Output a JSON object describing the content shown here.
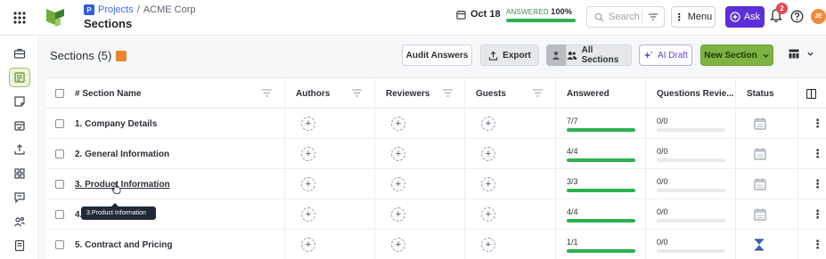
{
  "header": {
    "breadcrumb": {
      "project_link": "Projects",
      "separator": "/",
      "client": "ACME Corp"
    },
    "title": "Sections",
    "date": "Oct 18",
    "answered": {
      "label": "ANSWERED",
      "percent_text": "100%",
      "percent": 100
    },
    "search_placeholder": "Search",
    "menu_label": "Menu",
    "ask_label": "Ask",
    "notification_count": "2",
    "avatar_initials": "JE",
    "colors": {
      "ask": "#5b2fd9",
      "answered_bar": "#2eb050",
      "badge": "#e5484d",
      "avatar": "#f08a3b"
    }
  },
  "rail": {
    "items": [
      "briefcase-icon",
      "sections-icon",
      "notes-icon",
      "calendar-check-icon",
      "upload-icon",
      "grid-icon",
      "chat-icon",
      "people-icon",
      "library-icon"
    ],
    "active_index": 1
  },
  "toolbar": {
    "title": "Sections (5)",
    "audit_label": "Audit Answers",
    "export_label": "Export",
    "all_sections_label": "All Sections",
    "ai_draft_label": "AI Draft",
    "new_section_label": "New Section"
  },
  "table": {
    "columns": [
      "# Section Name",
      "Authors",
      "Reviewers",
      "Guests",
      "Answered",
      "Questions Revie...",
      "Status"
    ],
    "rows": [
      {
        "name": "1. Company Details",
        "answered": "7/7",
        "answered_pct": 100,
        "reviewed": "0/0",
        "status_icon": "calendar-icon"
      },
      {
        "name": "2. General Information",
        "answered": "4/4",
        "answered_pct": 100,
        "reviewed": "0/0",
        "status_icon": "calendar-icon"
      },
      {
        "name": "3. Product Information",
        "answered": "3/3",
        "answered_pct": 100,
        "reviewed": "0/0",
        "status_icon": "calendar-icon"
      },
      {
        "name": "4.",
        "answered": "4/4",
        "answered_pct": 100,
        "reviewed": "0/0",
        "status_icon": "calendar-icon"
      },
      {
        "name": "5. Contract and Pricing",
        "answered": "1/1",
        "answered_pct": 100,
        "reviewed": "0/0",
        "status_icon": "hourglass-icon"
      }
    ],
    "add_symbol": "+",
    "kebab": "⋮"
  },
  "tooltip": {
    "text": "3.Product Information"
  }
}
